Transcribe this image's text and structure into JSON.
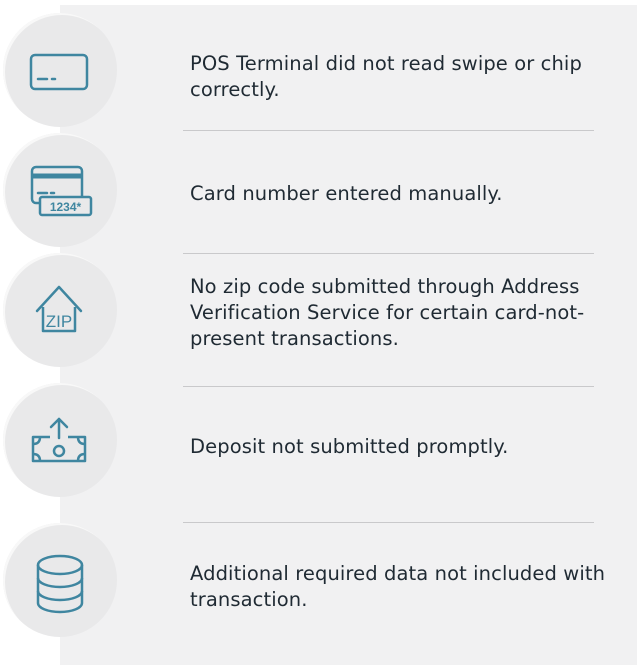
{
  "colors": {
    "icon": "#3f86a0",
    "panel": "#f1f1f2",
    "circle": "#e9e9ea",
    "text": "#1f2a33",
    "divider": "#c9c9cb"
  },
  "items": [
    {
      "icon": "credit-card-icon",
      "text": "POS Terminal did not read swipe or chip correctly."
    },
    {
      "icon": "manual-card-entry-icon",
      "text": "Card number entered manually.",
      "icon_label": "1234*"
    },
    {
      "icon": "zip-house-icon",
      "text": "No zip code submitted through Address Verification Service for certain card-not-present transactions.",
      "icon_label": "ZIP"
    },
    {
      "icon": "deposit-upload-icon",
      "text": "Deposit not submitted promptly."
    },
    {
      "icon": "database-icon",
      "text": "Additional required data not included with transaction."
    }
  ]
}
